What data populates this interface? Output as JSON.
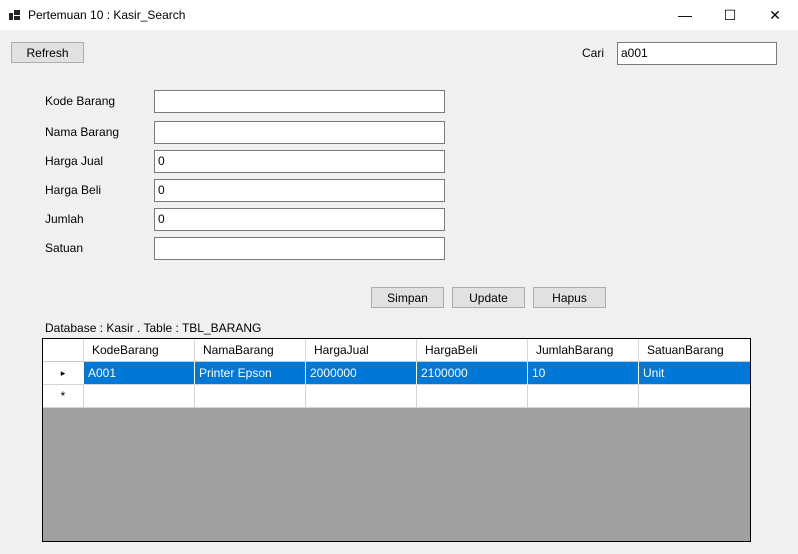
{
  "window": {
    "title": "Pertemuan 10 : Kasir_Search",
    "minimize": "—",
    "maximize": "☐",
    "close": "✕"
  },
  "toolbar": {
    "refresh_label": "Refresh",
    "search_label": "Cari",
    "search_value": "a001"
  },
  "form": {
    "fields": [
      {
        "label": "Kode Barang",
        "value": ""
      },
      {
        "label": "Nama Barang",
        "value": ""
      },
      {
        "label": "Harga Jual",
        "value": "0"
      },
      {
        "label": "Harga Beli",
        "value": "0"
      },
      {
        "label": "Jumlah",
        "value": "0"
      },
      {
        "label": "Satuan",
        "value": ""
      }
    ],
    "buttons": {
      "save": "Simpan",
      "update": "Update",
      "delete": "Hapus"
    }
  },
  "grid": {
    "caption": "Database : Kasir . Table : TBL_BARANG",
    "columns": [
      "KodeBarang",
      "NamaBarang",
      "HargaJual",
      "HargaBeli",
      "JumlahBarang",
      "SatuanBarang"
    ],
    "rows": [
      [
        "A001",
        "Printer Epson",
        "2000000",
        "2100000",
        "10",
        "Unit"
      ]
    ],
    "selected_row_marker": "▸",
    "new_row_marker": "*",
    "selection_color": "#0078d7",
    "background_color": "#a0a0a0"
  }
}
